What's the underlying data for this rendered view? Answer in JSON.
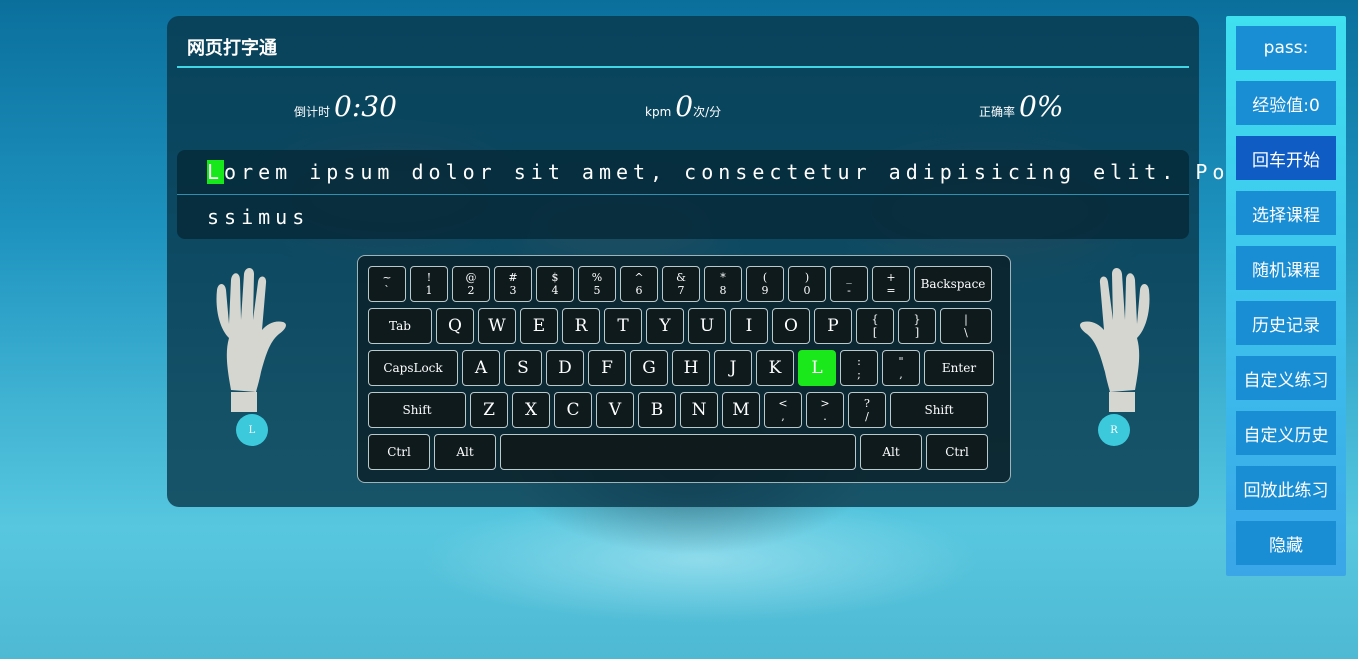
{
  "app": {
    "title": "网页打字通"
  },
  "stats": {
    "countdown": {
      "label": "倒计时",
      "value": "0:30"
    },
    "kpm": {
      "label": "kpm",
      "value": "0",
      "unit": "次/分"
    },
    "accuracy": {
      "label": "正确率",
      "value": "0%"
    }
  },
  "practice_text": {
    "current_char": "L",
    "line1_rest": "orem ipsum dolor sit amet, consectetur adipisicing elit. Po",
    "line2": "ssimus"
  },
  "keyboard": {
    "row1": [
      {
        "top": "~",
        "bottom": "`"
      },
      {
        "top": "!",
        "bottom": "1"
      },
      {
        "top": "@",
        "bottom": "2"
      },
      {
        "top": "#",
        "bottom": "3"
      },
      {
        "top": "$",
        "bottom": "4"
      },
      {
        "top": "%",
        "bottom": "5"
      },
      {
        "top": "^",
        "bottom": "6"
      },
      {
        "top": "&",
        "bottom": "7"
      },
      {
        "top": "*",
        "bottom": "8"
      },
      {
        "top": "(",
        "bottom": "9"
      },
      {
        "top": ")",
        "bottom": "0"
      },
      {
        "top": "_",
        "bottom": "-"
      },
      {
        "top": "+",
        "bottom": "="
      }
    ],
    "backspace": "Backspace",
    "tab": "Tab",
    "row2_letters": [
      "Q",
      "W",
      "E",
      "R",
      "T",
      "Y",
      "U",
      "I",
      "O",
      "P"
    ],
    "row2_symbols": [
      {
        "top": "{",
        "bottom": "["
      },
      {
        "top": "}",
        "bottom": "]"
      },
      {
        "top": "|",
        "bottom": "\\"
      }
    ],
    "capslock": "CapsLock",
    "row3_letters": [
      "A",
      "S",
      "D",
      "F",
      "G",
      "H",
      "J",
      "K",
      "L"
    ],
    "row3_symbols": [
      {
        "top": ":",
        "bottom": ";"
      },
      {
        "top": "\"",
        "bottom": ","
      }
    ],
    "enter": "Enter",
    "shift": "Shift",
    "row4_letters": [
      "Z",
      "X",
      "C",
      "V",
      "B",
      "N",
      "M"
    ],
    "row4_symbols": [
      {
        "top": "<",
        "bottom": ","
      },
      {
        "top": ">",
        "bottom": "."
      },
      {
        "top": "?",
        "bottom": "/"
      }
    ],
    "ctrl": "Ctrl",
    "alt": "Alt",
    "active_key": "L"
  },
  "hands": {
    "left_badge": "L",
    "right_badge": "R"
  },
  "sidebar": {
    "buttons": [
      "pass:",
      "经验值:0",
      "回车开始",
      "选择课程",
      "随机课程",
      "历史记录",
      "自定义练习",
      "自定义历史",
      "回放此练习",
      "隐藏"
    ],
    "active_button": "回车开始"
  },
  "colors": {
    "accent": "#3fd6e6",
    "active_key": "#1be81b",
    "sidebar_button": "#1a8ed4"
  },
  "icons": {
    "left_hand": "left-hand-icon",
    "right_hand": "right-hand-icon"
  }
}
